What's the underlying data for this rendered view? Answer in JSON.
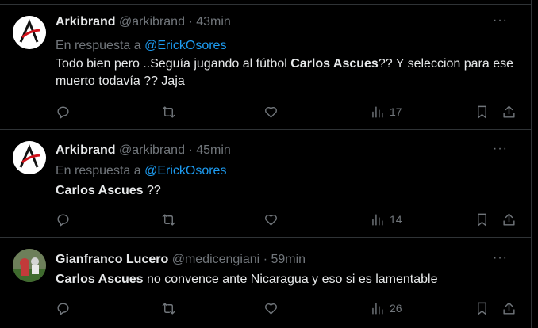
{
  "tweets": [
    {
      "name": "Arkibrand",
      "handle": "@arkibrand",
      "separator": "·",
      "time": "43min",
      "reply_prefix": "En respuesta a",
      "reply_to": "@ErickOsores",
      "text_parts": [
        "Todo bien pero ..Seguía jugando al fútbol ",
        "Carlos Ascues",
        "?? Y seleccion para ese muerto todavía ?? Jaja"
      ],
      "views": "17",
      "more": "···"
    },
    {
      "name": "Arkibrand",
      "handle": "@arkibrand",
      "separator": "·",
      "time": "45min",
      "reply_prefix": "En respuesta a",
      "reply_to": "@ErickOsores",
      "text_parts": [
        "",
        "Carlos Ascues",
        " ??"
      ],
      "views": "14",
      "more": "···"
    },
    {
      "name": "Gianfranco Lucero",
      "handle": "@medicengiani",
      "separator": "·",
      "time": "59min",
      "text_parts": [
        "",
        "Carlos Ascues",
        " no convence ante Nicaragua y eso si es lamentable"
      ],
      "views": "26",
      "more": "···"
    }
  ],
  "icons": {
    "reply": "reply-icon",
    "retweet": "retweet-icon",
    "like": "heart-icon",
    "views": "views-icon",
    "bookmark": "bookmark-icon",
    "share": "share-icon"
  },
  "colors": {
    "background": "#000000",
    "text": "#e7e9ea",
    "muted": "#71767b",
    "link": "#1d9bf0",
    "border": "#2f3336"
  }
}
